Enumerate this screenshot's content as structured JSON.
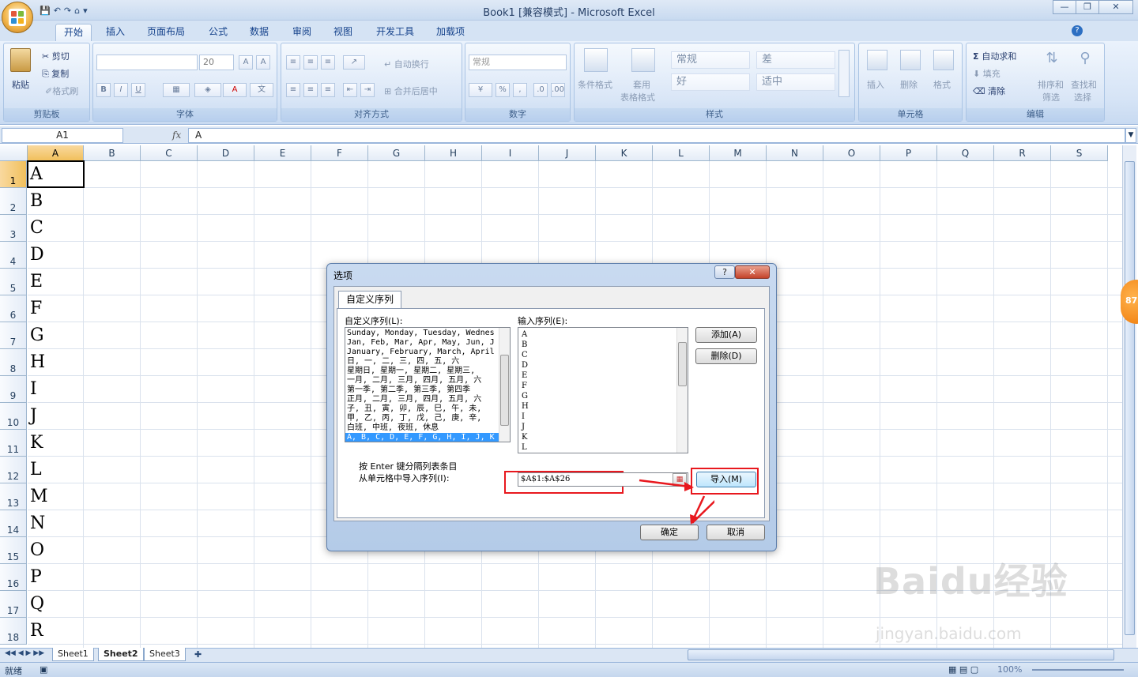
{
  "window": {
    "title": "Book1  [兼容模式] - Microsoft Excel",
    "minimize": "—",
    "restore": "❐",
    "close": "✕"
  },
  "quick_access": [
    "💾",
    "↶",
    "↷",
    "⌂",
    "▾"
  ],
  "ribbon_tabs": [
    "开始",
    "插入",
    "页面布局",
    "公式",
    "数据",
    "审阅",
    "视图",
    "开发工具",
    "加载项"
  ],
  "ribbon_help": "?",
  "clipboard": {
    "paste": "粘贴",
    "cut": "剪切",
    "copy": "复制",
    "format_painter": "格式刷",
    "label": "剪贴板"
  },
  "font": {
    "size": "20",
    "bold": "B",
    "italic": "I",
    "underline": "U",
    "label": "字体"
  },
  "alignment": {
    "wrap": "自动换行",
    "merge": "合并后居中",
    "label": "对齐方式"
  },
  "number": {
    "format": "常规",
    "percent": "%",
    "comma": ",",
    "label": "数字"
  },
  "styles": {
    "conditional": "条件格式",
    "table": "套用",
    "table2": "表格格式",
    "normal": "常规",
    "bad": "差",
    "good": "好",
    "neutral": "适中",
    "label": "样式"
  },
  "cells": {
    "insert": "插入",
    "delete": "删除",
    "format": "格式",
    "label": "单元格"
  },
  "editing": {
    "autosum": "自动求和",
    "fill": "填充",
    "clear": "清除",
    "sort": "排序和",
    "sort2": "筛选",
    "find": "查找和",
    "find2": "选择",
    "label": "编辑"
  },
  "formula_bar": {
    "name_box": "A1",
    "fx": "fx",
    "content": "A"
  },
  "columns": [
    "A",
    "B",
    "C",
    "D",
    "E",
    "F",
    "G",
    "H",
    "I",
    "J",
    "K",
    "L",
    "M",
    "N",
    "O",
    "P",
    "Q",
    "R",
    "S"
  ],
  "rows": [
    "1",
    "2",
    "3",
    "4",
    "5",
    "6",
    "7",
    "8",
    "9",
    "10",
    "11",
    "12",
    "13",
    "14",
    "15",
    "16",
    "17",
    "18"
  ],
  "column_a_values": [
    "A",
    "B",
    "C",
    "D",
    "E",
    "F",
    "G",
    "H",
    "I",
    "J",
    "K",
    "L",
    "M",
    "N",
    "O",
    "P",
    "Q",
    "R"
  ],
  "sheets": [
    "Sheet1",
    "Sheet2",
    "Sheet3"
  ],
  "status": {
    "ready": "就绪",
    "zoom": "100%"
  },
  "side_badge": "87",
  "dialog": {
    "title": "选项",
    "help": "?",
    "close": "✕",
    "tab": "自定义序列",
    "custom_lists_label": "自定义序列(L):",
    "custom_lists": [
      "Sunday, Monday, Tuesday, Wednes",
      "Jan, Feb, Mar, Apr, May, Jun, J",
      "January, February, March, April",
      "日, 一, 二, 三, 四, 五, 六",
      "星期日, 星期一, 星期二, 星期三,",
      "一月, 二月, 三月, 四月, 五月, 六",
      "第一季, 第二季, 第三季, 第四季",
      "正月, 二月, 三月, 四月, 五月, 六",
      "子, 丑, 寅, 卯, 辰, 巳, 午, 未,",
      "甲, 乙, 丙, 丁, 戊, 己, 庚, 辛,",
      "白班, 中班, 夜班, 休息",
      "A, B, C, D, E, F, G, H, I, J, K"
    ],
    "entries_label": "输入序列(E):",
    "entries": [
      "A",
      "B",
      "C",
      "D",
      "E",
      "F",
      "G",
      "H",
      "I",
      "J",
      "K",
      "L"
    ],
    "add_button": "添加(A)",
    "delete_button": "删除(D)",
    "hint_line1": "按 Enter 键分隔列表条目",
    "hint_line2": "从单元格中导入序列(I):",
    "import_range": "$A$1:$A$26",
    "import_button": "导入(M)",
    "ok_button": "确定",
    "cancel_button": "取消"
  },
  "watermark": {
    "brand": "Baidu经验",
    "url": "jingyan.baidu.com"
  },
  "colors": {
    "accent": "#3399ff",
    "highlight_red": "#e8181e",
    "ribbon_blue": "#d6e4f6"
  }
}
